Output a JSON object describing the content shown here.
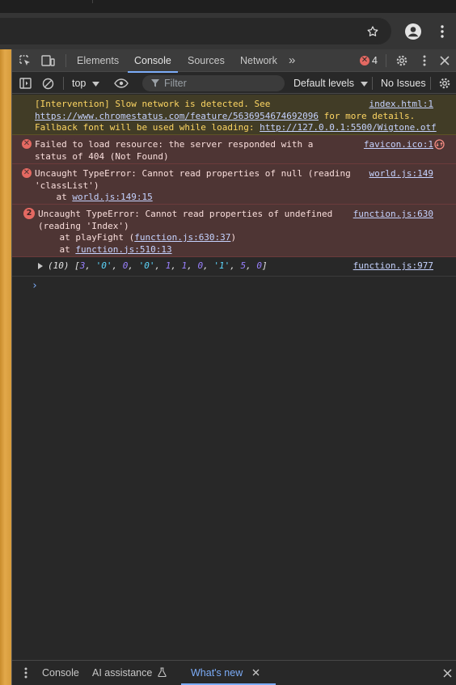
{
  "browser": {
    "star_icon": "star-icon",
    "profile_icon": "profile-icon",
    "menu_icon": "kebab-icon"
  },
  "devtools": {
    "tabs": [
      {
        "label": "Elements"
      },
      {
        "label": "Console",
        "active": true
      },
      {
        "label": "Sources"
      },
      {
        "label": "Network"
      }
    ],
    "more_tabs_glyph": "»",
    "error_count": "4",
    "error_glyph": "✕"
  },
  "console_toolbar": {
    "context": "top",
    "filter_placeholder": "Filter",
    "levels": "Default levels",
    "issues": "No Issues"
  },
  "messages": [
    {
      "level": "warning",
      "lines": [
        "[Intervention] Slow network is detected. See",
        "https://www.chromestatus.com/feature/5636954674692096",
        " for more details.",
        "Fallback font will be used while loading: ",
        "http://127.0.0.1:5500/Wigtone.otf"
      ],
      "source": "index.html:1"
    },
    {
      "level": "error",
      "lines": [
        "Failed to load resource: the server responded with a",
        "status of 404 (Not Found)"
      ],
      "source": "favicon.ico:1"
    },
    {
      "level": "error",
      "lines": [
        "Uncaught TypeError: Cannot read properties of null (reading",
        "'classList')",
        "    at ",
        "world.js:149:15"
      ],
      "source": "world.js:149"
    },
    {
      "level": "error",
      "count": "2",
      "lines": [
        "Uncaught TypeError: Cannot read properties of undefined",
        "(reading 'Index')",
        "    at playFight (",
        "function.js:630:37",
        ")",
        "    at ",
        "function.js:510:13"
      ],
      "source": "function.js:630"
    },
    {
      "level": "log",
      "array_length": "(10)",
      "array_items": [
        "3",
        "'0'",
        "0",
        "'0'",
        "1",
        "1",
        "0",
        "'1'",
        "5",
        "0"
      ],
      "source": "function.js:977"
    }
  ],
  "prompt_glyph": "›",
  "drawer": {
    "tabs": [
      {
        "label": "Console"
      },
      {
        "label": "AI assistance"
      },
      {
        "label": "What's new",
        "active": true
      }
    ]
  },
  "colors": {
    "accent": "#7cacf8",
    "error": "#e46962",
    "warning_text": "#fdd663"
  }
}
